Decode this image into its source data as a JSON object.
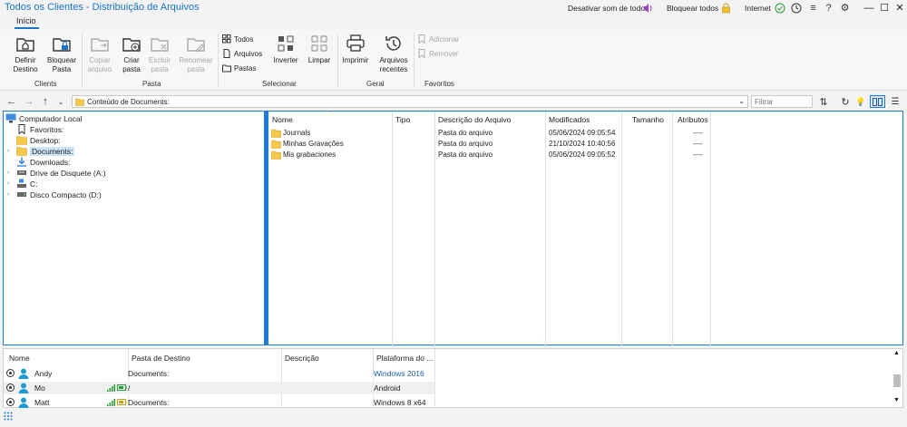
{
  "window": {
    "title": "Todos os Clientes - Distribuição de Arquivos",
    "mute_all_label": "Desativar som de todos",
    "lock_all_label": "Bloquear todos",
    "connection_label": "Internet"
  },
  "ribbon": {
    "tab": "Início",
    "groups": {
      "clients": "Clients",
      "pasta": "Pasta",
      "selecionar": "Selecionar",
      "geral": "Geral",
      "favoritos": "Favoritos"
    },
    "buttons": {
      "definir_destino": "Definir\nDestino",
      "bloquear_pasta": "Bloquear\nPasta",
      "copiar_arquivo": "Copiar\narquivo",
      "criar_pasta": "Criar\npasta",
      "excluir_pasta": "Excluir\npasta",
      "renomear_pasta": "Renomear\npasta",
      "todos": "Todos",
      "arquivos": "Arquivos",
      "pastas": "Pastas",
      "inverter": "Inverter",
      "limpar": "Limpar",
      "imprimir": "Imprimir",
      "arquivos_recentes": "Arquivos\nrecentes",
      "adicionar": "Adicionar",
      "remover": "Remover"
    }
  },
  "address_bar": {
    "path": "Conteúdo de  Documents:",
    "filter_placeholder": "Filtrar"
  },
  "tree": {
    "root": "Computador Local",
    "items": [
      "Favoritos:",
      "Desktop:",
      "Documents:",
      "Downloads:",
      "Drive de Disquete (A:)",
      "C:",
      "Disco Compacto (D:)"
    ]
  },
  "files": {
    "columns": [
      "Nome",
      "Tipo",
      "Descrição do Arquivo",
      "Modificados",
      "Tamanho",
      "Atributos"
    ],
    "rows": [
      {
        "name": "Journals",
        "type": "",
        "desc": "Pasta do arquivo",
        "modified": "05/06/2024 09:05:54",
        "size": "",
        "attrs": "----"
      },
      {
        "name": "Minhas Gravações",
        "type": "",
        "desc": "Pasta do arquivo",
        "modified": "21/10/2024 10:40:56",
        "size": "",
        "attrs": "----"
      },
      {
        "name": "Mis grabaciones",
        "type": "",
        "desc": "Pasta do arquivo",
        "modified": "05/06/2024 09:05:52",
        "size": "",
        "attrs": "----"
      }
    ]
  },
  "clients": {
    "columns": [
      "Nome",
      "Pasta de Destino",
      "Descrição",
      "Plataforma do ..."
    ],
    "rows": [
      {
        "name": "Andy",
        "dest": "Documents:",
        "desc": "",
        "platform": "Windows 2016"
      },
      {
        "name": "Mo",
        "dest": "/",
        "desc": "",
        "platform": "Android"
      },
      {
        "name": "Matt",
        "dest": "Documents:",
        "desc": "",
        "platform": "Windows 8 x64"
      }
    ]
  },
  "colors": {
    "accent": "#1a73c9",
    "pane_border": "#1f7ad6",
    "folder": "#f5c84a"
  },
  "icons": [
    "speaker-icon",
    "lock-icon",
    "check-circle-icon",
    "clock-icon",
    "menu-icon",
    "help-icon",
    "gear-icon",
    "folder-icon",
    "user-icon",
    "signal-icon",
    "battery-icon"
  ]
}
